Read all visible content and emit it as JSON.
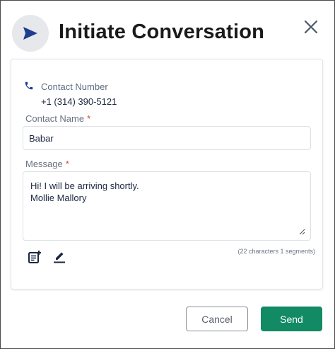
{
  "dialog": {
    "title": "Initiate Conversation"
  },
  "contact_number": {
    "label": "Contact Number",
    "value": "+1 (314) 390-5121"
  },
  "contact_name": {
    "label": "Contact Name",
    "required_mark": "*",
    "value": "Babar"
  },
  "message": {
    "label": "Message",
    "required_mark": "*",
    "value": "Hi! I will be arriving shortly.\nMollie Mallory",
    "counter": "(22 characters 1 segments)"
  },
  "actions": {
    "cancel_label": "Cancel",
    "send_label": "Send"
  },
  "icons": {
    "header": "send-icon",
    "close": "close-icon",
    "phone": "phone-icon",
    "template": "add-template-icon",
    "signature": "signature-edit-icon"
  },
  "colors": {
    "accent": "#1e3f8f",
    "send_button": "#128a64",
    "required": "#d0443e"
  }
}
